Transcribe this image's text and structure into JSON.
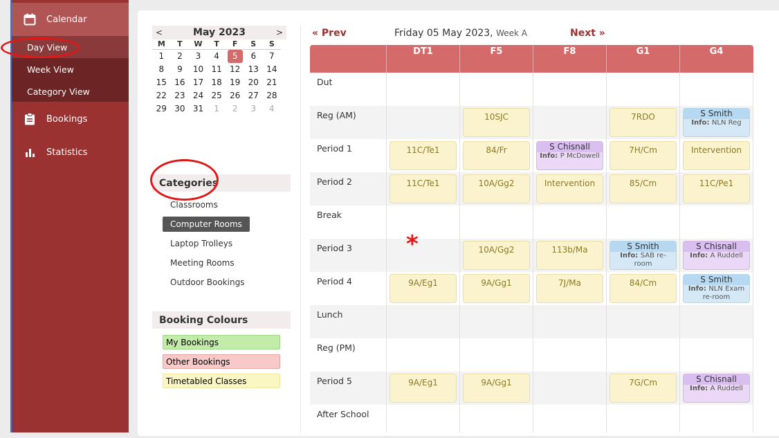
{
  "sidebar": {
    "calendar_label": "Calendar",
    "day_view": "Day View",
    "week_view": "Week View",
    "category_view": "Category View",
    "bookings_label": "Bookings",
    "statistics_label": "Statistics"
  },
  "mini_calendar": {
    "month_label": "May 2023",
    "prev": "<",
    "next": ">",
    "day_headers": [
      "M",
      "T",
      "W",
      "T",
      "F",
      "S",
      "S"
    ],
    "weeks": [
      [
        "1",
        "2",
        "3",
        "4",
        "5",
        "6",
        "7"
      ],
      [
        "8",
        "9",
        "10",
        "11",
        "12",
        "13",
        "14"
      ],
      [
        "15",
        "16",
        "17",
        "18",
        "19",
        "20",
        "21"
      ],
      [
        "22",
        "23",
        "24",
        "25",
        "26",
        "27",
        "28"
      ],
      [
        "29",
        "30",
        "31",
        "1",
        "2",
        "3",
        "4"
      ]
    ],
    "selected_day": "5"
  },
  "categories": {
    "heading": "Categories",
    "items": [
      "Classrooms",
      "Computer Rooms",
      "Laptop Trolleys",
      "Meeting Rooms",
      "Outdoor Bookings"
    ],
    "active": "Computer Rooms"
  },
  "booking_colours": {
    "heading": "Booking Colours",
    "items": [
      {
        "label": "My Bookings",
        "color": "#c3ecaa",
        "border": "#9fd884"
      },
      {
        "label": "Other Bookings",
        "color": "#f7c9c9",
        "border": "#e6a3a3"
      },
      {
        "label": "Timetabled Classes",
        "color": "#fbf7c2",
        "border": "#eee7a0"
      }
    ]
  },
  "day_nav": {
    "prev": "« Prev",
    "date": "Friday 05 May 2023,",
    "week": "Week A",
    "next": "Next »"
  },
  "timetable": {
    "rooms": [
      "DT1",
      "F5",
      "F8",
      "G1",
      "G4"
    ],
    "periods": [
      "Dut",
      "Reg (AM)",
      "Period 1",
      "Period 2",
      "Break",
      "Period 3",
      "Period 4",
      "Lunch",
      "Reg (PM)",
      "Period 5",
      "After School"
    ],
    "bookings": [
      {
        "row": 1,
        "col": 1,
        "type": "class",
        "text": "10SJC"
      },
      {
        "row": 1,
        "col": 3,
        "type": "class",
        "text": "7RDO"
      },
      {
        "row": 1,
        "col": 4,
        "type": "blue",
        "name": "S Smith",
        "info": "NLN Reg"
      },
      {
        "row": 2,
        "col": 0,
        "type": "class",
        "text": "11C/Te1"
      },
      {
        "row": 2,
        "col": 1,
        "type": "class",
        "text": "84/Fr"
      },
      {
        "row": 2,
        "col": 2,
        "type": "purple",
        "name": "S Chisnall",
        "info": "P McDowell"
      },
      {
        "row": 2,
        "col": 3,
        "type": "class",
        "text": "7H/Cm"
      },
      {
        "row": 2,
        "col": 4,
        "type": "class",
        "text": "Intervention"
      },
      {
        "row": 3,
        "col": 0,
        "type": "class",
        "text": "11C/Te1"
      },
      {
        "row": 3,
        "col": 1,
        "type": "class",
        "text": "10A/Gg2"
      },
      {
        "row": 3,
        "col": 2,
        "type": "class",
        "text": "Intervention"
      },
      {
        "row": 3,
        "col": 3,
        "type": "class",
        "text": "85/Cm"
      },
      {
        "row": 3,
        "col": 4,
        "type": "class",
        "text": "11C/Pe1"
      },
      {
        "row": 5,
        "col": 1,
        "type": "class",
        "text": "10A/Gg2"
      },
      {
        "row": 5,
        "col": 2,
        "type": "class",
        "text": "113b/Ma"
      },
      {
        "row": 5,
        "col": 3,
        "type": "blue",
        "name": "S Smith",
        "info": "SAB re-room"
      },
      {
        "row": 5,
        "col": 4,
        "type": "purple",
        "name": "S Chisnall",
        "info": "A Ruddell"
      },
      {
        "row": 6,
        "col": 0,
        "type": "class",
        "text": "9A/Eg1"
      },
      {
        "row": 6,
        "col": 1,
        "type": "class",
        "text": "9A/Gg1"
      },
      {
        "row": 6,
        "col": 2,
        "type": "class",
        "text": "7J/Ma"
      },
      {
        "row": 6,
        "col": 3,
        "type": "class",
        "text": "84/Cm"
      },
      {
        "row": 6,
        "col": 4,
        "type": "blue",
        "name": "S Smith",
        "info": "NLN Exam re-room"
      },
      {
        "row": 9,
        "col": 0,
        "type": "class",
        "text": "9A/Eg1"
      },
      {
        "row": 9,
        "col": 1,
        "type": "class",
        "text": "9A/Gg1"
      },
      {
        "row": 9,
        "col": 3,
        "type": "class",
        "text": "7G/Cm"
      },
      {
        "row": 9,
        "col": 4,
        "type": "purple",
        "name": "S Chisnall",
        "info": "A Ruddell"
      }
    ],
    "info_label": "Info:"
  },
  "annotation": {
    "mark": "*",
    "color": "#e01818"
  }
}
